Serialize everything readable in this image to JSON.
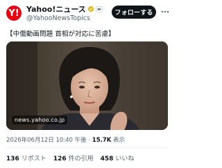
{
  "account": {
    "avatar_text": "Y!",
    "display_name": "Yahoo!ニュース",
    "handle": "@YahooNewsTopics",
    "verified_color": "#e2b719"
  },
  "follow_button": {
    "label": "フォローする"
  },
  "more_menu": {
    "icon": "more-dots-icon"
  },
  "tweet": {
    "text": "【中傷動画問題 首相が対応に苦慮】"
  },
  "media": {
    "watermark": "news.yahoo.co.jp",
    "alt_subject": "photo"
  },
  "meta": {
    "timestamp": "2026年06月12日 10:40 午後",
    "separator": "·",
    "views_count": "15.7K",
    "views_label": "表示"
  },
  "stats": {
    "reposts_count": "136",
    "reposts_label": "リポスト",
    "quotes_count": "126",
    "quotes_label": "件の引用",
    "likes_count": "458",
    "likes_label": "いいね"
  },
  "colors": {
    "brand_red": "#e60012",
    "follow_bg": "#0f1419",
    "secondary_text": "#536471"
  }
}
